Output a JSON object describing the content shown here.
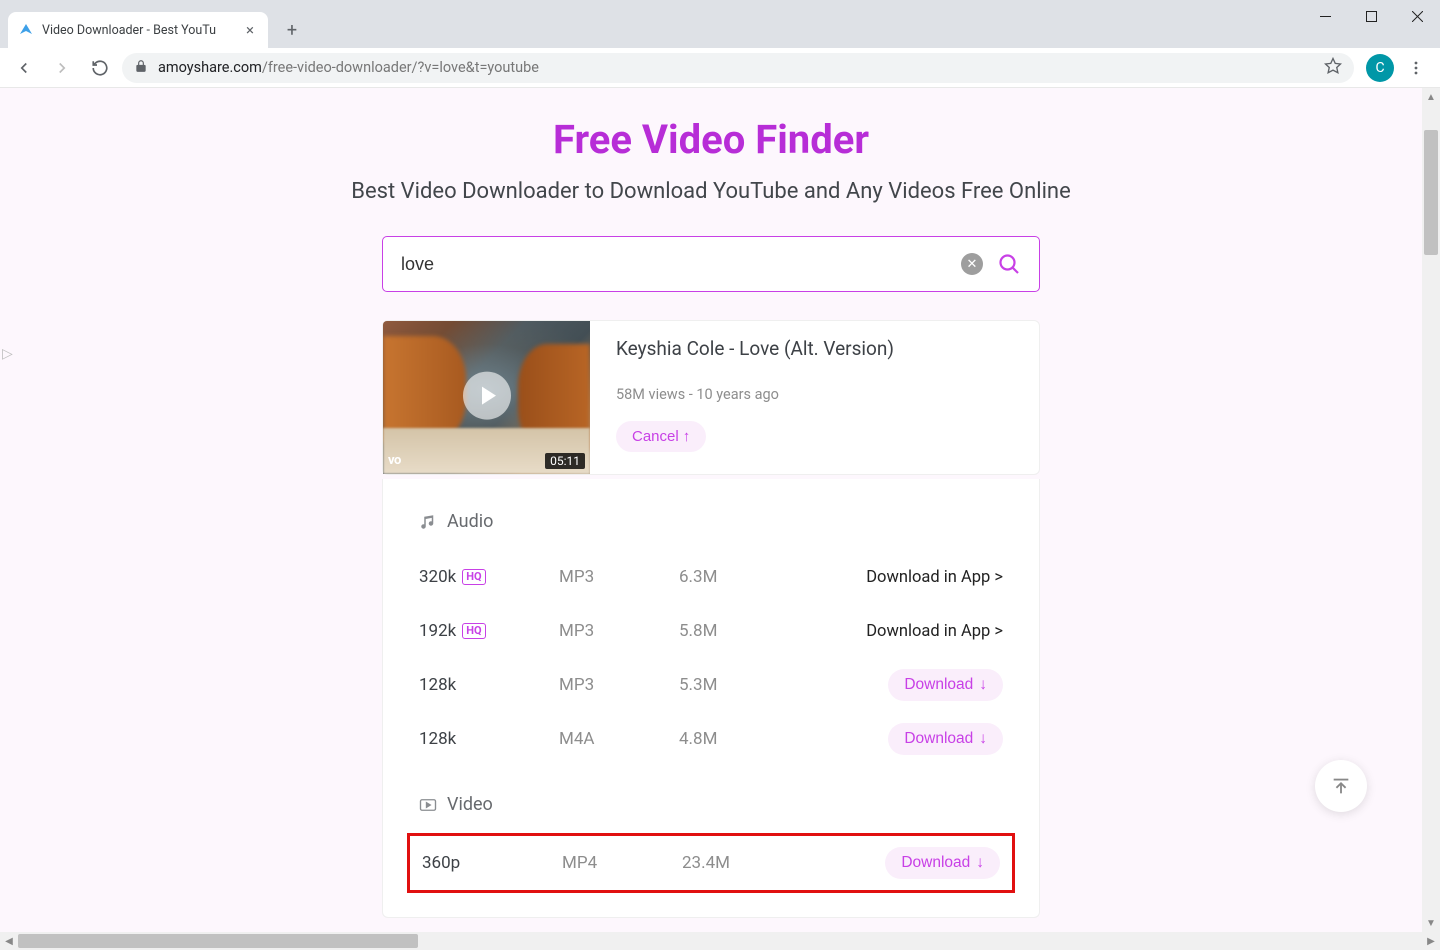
{
  "browser": {
    "tab_title": "Video Downloader - Best YouTu",
    "url_domain": "amoyshare.com",
    "url_path": "/free-video-downloader/?v=love&t=youtube",
    "avatar_letter": "C"
  },
  "page": {
    "title": "Free Video Finder",
    "subtitle": "Best Video Downloader to Download YouTube and Any Videos Free Online"
  },
  "search": {
    "value": "love"
  },
  "result": {
    "title": "Keyshia Cole - Love (Alt. Version)",
    "meta": "58M views - 10 years ago",
    "cancel_label": "Cancel",
    "duration": "05:11",
    "watermark": "vo"
  },
  "sections": {
    "audio_label": "Audio",
    "video_label": "Video"
  },
  "audio_formats": [
    {
      "quality": "320k",
      "hq": true,
      "format": "MP3",
      "size": "6.3M",
      "action": "app",
      "action_label": "Download in App >"
    },
    {
      "quality": "192k",
      "hq": true,
      "format": "MP3",
      "size": "5.8M",
      "action": "app",
      "action_label": "Download in App >"
    },
    {
      "quality": "128k",
      "hq": false,
      "format": "MP3",
      "size": "5.3M",
      "action": "download",
      "action_label": "Download"
    },
    {
      "quality": "128k",
      "hq": false,
      "format": "M4A",
      "size": "4.8M",
      "action": "download",
      "action_label": "Download"
    }
  ],
  "video_formats": [
    {
      "quality": "360p",
      "format": "MP4",
      "size": "23.4M",
      "action": "download",
      "action_label": "Download",
      "highlighted": true
    }
  ]
}
